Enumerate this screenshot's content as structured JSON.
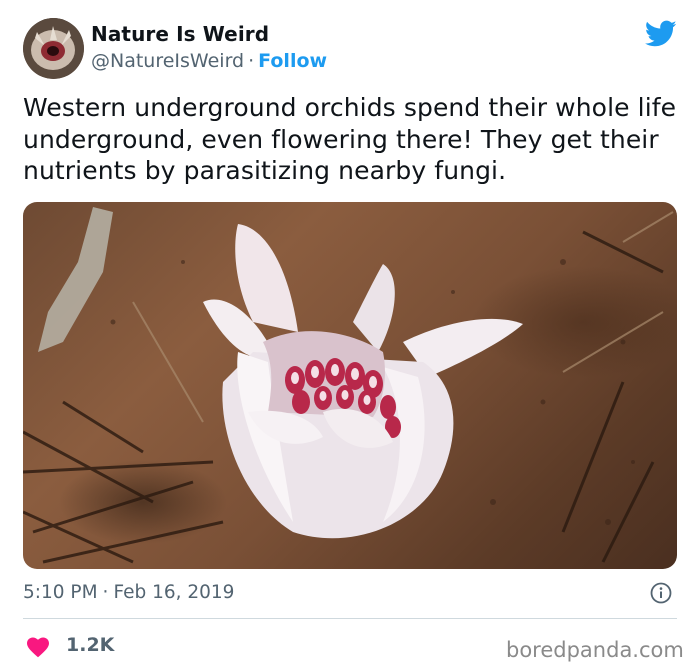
{
  "header": {
    "display_name": "Nature Is Weird",
    "handle": "@NatureIsWeird",
    "separator": "·",
    "follow_label": "Follow",
    "avatar_icon": "orchid-avatar-icon",
    "brand_icon": "twitter-bird-icon"
  },
  "tweet": {
    "text": "Western underground orchids spend their whole life underground, even flowering there! They get their nutrients by parasitizing nearby fungi.",
    "media_icon": "orchid-photo"
  },
  "meta": {
    "time": "5:10 PM",
    "separator": "·",
    "date": "Feb 16, 2019",
    "info_icon": "info-icon"
  },
  "engagement": {
    "like_count": "1.2K",
    "like_icon": "heart-icon"
  },
  "watermark": {
    "text": "boredpanda.com"
  },
  "colors": {
    "accent": "#1d9bf0",
    "heart": "#f91880",
    "text": "#0f1419",
    "secondary": "#536471",
    "divider": "#cfd9de"
  }
}
